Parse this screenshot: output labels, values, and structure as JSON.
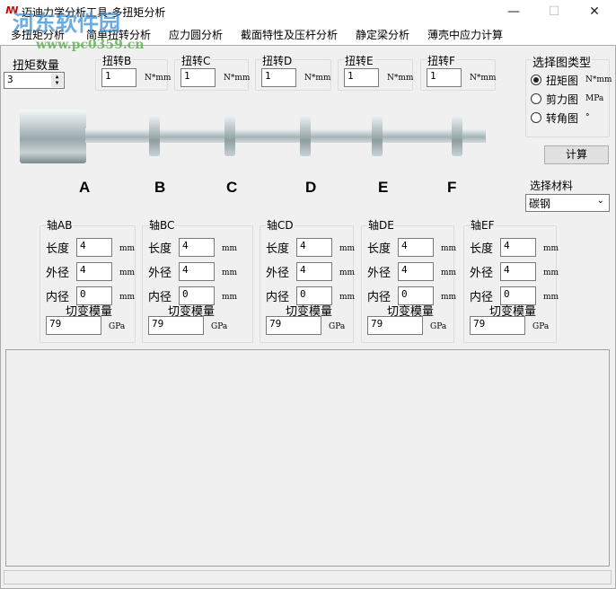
{
  "window": {
    "title": "迈迪力学分析工具-多扭矩分析",
    "minimize": "—",
    "maximize": "☐",
    "close": "✕"
  },
  "watermark": {
    "name": "河东软件园",
    "url": "www.pc0359.cn"
  },
  "menu": [
    "多扭矩分析",
    "简单扭转分析",
    "应力圆分析",
    "截面特性及压杆分析",
    "静定梁分析",
    "薄壳中应力计算"
  ],
  "torque_count": {
    "label": "扭矩数量",
    "value": "3"
  },
  "torques": [
    {
      "label": "扭转B",
      "value": "1",
      "unit": "N*mm"
    },
    {
      "label": "扭转C",
      "value": "1",
      "unit": "N*mm"
    },
    {
      "label": "扭转D",
      "value": "1",
      "unit": "N*mm"
    },
    {
      "label": "扭转E",
      "value": "1",
      "unit": "N*mm"
    },
    {
      "label": "扭转F",
      "value": "1",
      "unit": "N*mm"
    }
  ],
  "chart_type": {
    "label": "选择图类型",
    "options": [
      {
        "label": "扭矩图",
        "unit": "N*mm",
        "selected": true
      },
      {
        "label": "剪力图",
        "unit": "MPa",
        "selected": false
      },
      {
        "label": "转角图",
        "unit": "°",
        "selected": false
      }
    ]
  },
  "calc_button": "计算",
  "points": [
    "A",
    "B",
    "C",
    "D",
    "E",
    "F"
  ],
  "material": {
    "label": "选择材料",
    "value": "碳钢"
  },
  "shafts": [
    {
      "label": "轴AB",
      "length": "4",
      "outer": "4",
      "inner": "0",
      "modulus": "79"
    },
    {
      "label": "轴BC",
      "length": "4",
      "outer": "4",
      "inner": "0",
      "modulus": "79"
    },
    {
      "label": "轴CD",
      "length": "4",
      "outer": "4",
      "inner": "0",
      "modulus": "79"
    },
    {
      "label": "轴DE",
      "length": "4",
      "outer": "4",
      "inner": "0",
      "modulus": "79"
    },
    {
      "label": "轴EF",
      "length": "4",
      "outer": "4",
      "inner": "0",
      "modulus": "79"
    }
  ],
  "shaft_labels": {
    "length": "长度",
    "outer": "外径",
    "inner": "内径",
    "modulus": "切变模量",
    "mm": "mm",
    "gpa": "GPa"
  }
}
